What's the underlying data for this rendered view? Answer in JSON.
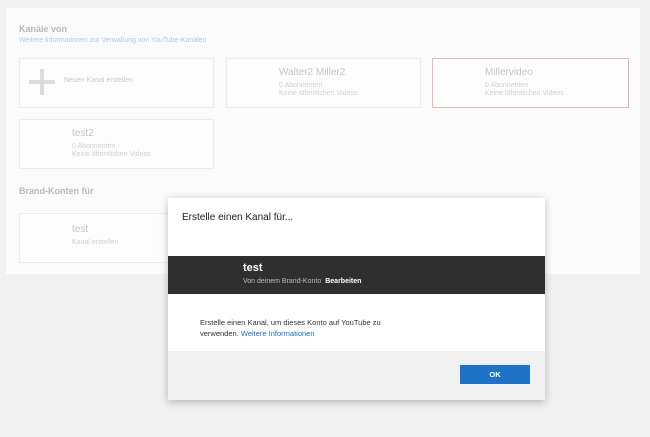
{
  "channels_section": {
    "title": "Kanäle von",
    "info_link": "Weitere Informationen zur Verwaltung von YouTube-Kanälen"
  },
  "new_channel": {
    "label": "Neuen Kanal erstellen",
    "icon": "plus-icon"
  },
  "channels": [
    {
      "name": "Walter2 Miller2",
      "subscribers": "0 Abonnenten",
      "videos": "Keine öffentlichen Videos"
    },
    {
      "name": "Millervideo",
      "subscribers": "0 Abonnenten",
      "videos": "Keine öffentlichen Videos"
    },
    {
      "name": "test2",
      "subscribers": "0 Abonnenten",
      "videos": "Keine öffentlichen Videos"
    }
  ],
  "brand_section": {
    "title": "Brand-Konten für"
  },
  "brand_accounts": [
    {
      "name": "test",
      "sub": "Kanal erstellen"
    }
  ],
  "dialog": {
    "title": "Erstelle einen Kanal für...",
    "account": {
      "name": "test",
      "source": "Von deinem Brand-Konto",
      "edit_label": "Bearbeiten"
    },
    "description": "Erstelle einen Kanal, um dieses Konto auf YouTube zu verwenden.",
    "info_link": "Weitere Informationen",
    "ok_label": "OK"
  },
  "colors": {
    "accent": "#1e73c8",
    "account_bar": "#2f2f2f",
    "selected_border": "#e8b4b4",
    "link": "#1a6ec0"
  }
}
